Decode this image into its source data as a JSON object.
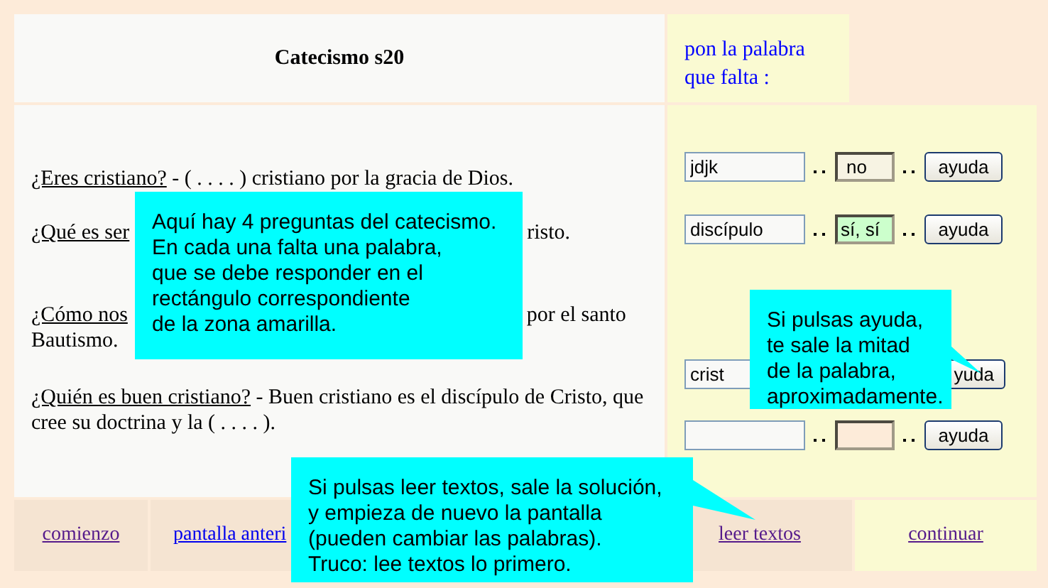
{
  "title": "Catecismo s20",
  "instruction": "pon la palabra que falta :",
  "questions": [
    {
      "segments": [
        {
          "kind": "underlined",
          "text": "¿Eres cristiano?"
        },
        {
          "kind": "plain",
          "text": " - ( . . . . ) cristiano por la gracia de Dios."
        }
      ]
    },
    {
      "segments": [
        {
          "kind": "underlined",
          "text": "¿Qué es ser"
        },
        {
          "kind": "covered"
        },
        {
          "kind": "plain",
          "text": "risto."
        }
      ]
    },
    {
      "segments": [
        {
          "kind": "underlined",
          "text": "¿Cómo nos"
        },
        {
          "kind": "covered"
        },
        {
          "kind": "plain",
          "text": "por el santo"
        },
        {
          "kind": "plain",
          "text": "Bautismo."
        }
      ]
    },
    {
      "segments": [
        {
          "kind": "underlined",
          "text": "¿Quién es buen cristiano?"
        },
        {
          "kind": "plain",
          "text": " - Buen cristiano es el discípulo de Cristo, que cree su doctrina y la ( . . . . )."
        }
      ]
    }
  ],
  "answers": [
    {
      "value": "jdjk",
      "result": {
        "kind": "wrong",
        "text": "no"
      },
      "button": "ayuda"
    },
    {
      "value": "discípulo",
      "result": {
        "kind": "right",
        "text": "sí, sí"
      },
      "button": "ayuda"
    },
    {
      "value": "crist",
      "button": "yuda"
    },
    {
      "result": {
        "kind": "empty"
      },
      "button": "ayuda"
    }
  ],
  "footer": [
    {
      "label": "comienzo",
      "visited": true
    },
    {
      "label": "pantalla anteri",
      "visited": false
    },
    {
      "label": "leer textos",
      "visited": true
    },
    {
      "label": "continuar",
      "visited": true
    }
  ],
  "callouts": [
    {
      "text": "Aquí hay 4 preguntas del catecismo.\nEn cada una falta una palabra,\nque se debe responder en el\nrectángulo correspondiente\nde la zona amarilla."
    },
    {
      "text": "Si pulsas ayuda,\nte sale la mitad\nde la palabra,\naproximadamente."
    },
    {
      "text": "Si pulsas leer textos, sale la solución,\ny empieza de nuevo la pantalla\n(pueden cambiar las palabras).\nTruco: lee textos lo primero."
    }
  ]
}
